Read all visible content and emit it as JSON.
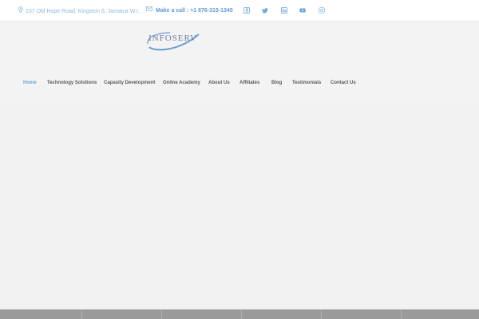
{
  "topbar": {
    "address": "237 Old Hope Road, Kingston 6, Jamaica W.I.",
    "phone": "Make a call : +1 876-315-1345",
    "social_icons": [
      "facebook-icon",
      "twitter-icon",
      "linkedin-icon",
      "youtube-icon",
      "instagram-icon"
    ]
  },
  "logo": {
    "text": "INFOSERV"
  },
  "nav": {
    "items": [
      {
        "label": "Home",
        "active": true
      },
      {
        "label": "Technology Solutions"
      },
      {
        "label": "Capasity Development"
      },
      {
        "label": "Online Academy"
      },
      {
        "label": "About Us"
      },
      {
        "label": "Affiliates"
      },
      {
        "label": "Blog"
      },
      {
        "label": "Testimonials"
      },
      {
        "label": "Contact Us"
      }
    ]
  },
  "colors": {
    "accent": "#6aa7da",
    "background": "#f3f3f3",
    "footer": "#9a9a9a"
  }
}
